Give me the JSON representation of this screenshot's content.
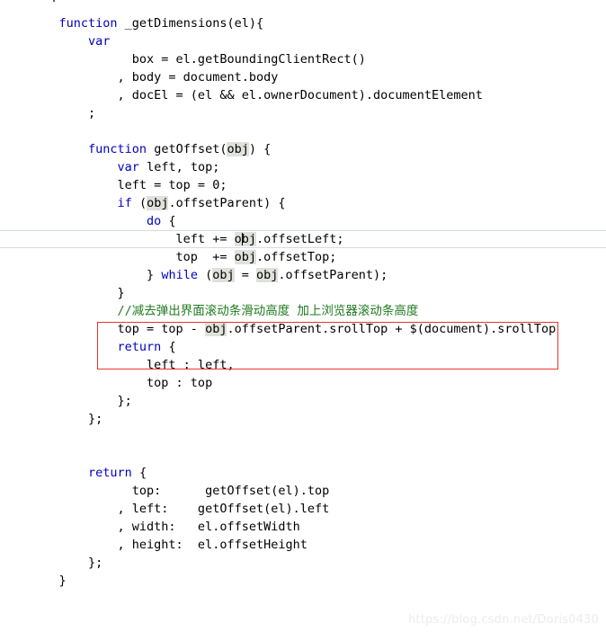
{
  "editor": {
    "language": "JavaScript",
    "background_color": "#ffffff",
    "keyword_color": "#0000c0",
    "comment_color": "#1f7a1f",
    "text_color": "#000000",
    "occurrence_highlight_color": "#dfe2da",
    "current_line_rule_color": "#d3dbe8",
    "top_clipped_glyph": "}",
    "lines": [
      {
        "id": 1,
        "indent": 3,
        "text": ""
      },
      {
        "id": 2,
        "indent": 3,
        "text": "function _getDimensions(el){"
      },
      {
        "id": 3,
        "indent": 7,
        "text": "var"
      },
      {
        "id": 4,
        "indent": 13,
        "text": "box = el.getBoundingClientRect()"
      },
      {
        "id": 5,
        "indent": 11,
        "text": ", body = document.body"
      },
      {
        "id": 6,
        "indent": 11,
        "text": ", docEl = (el && el.ownerDocument).documentElement"
      },
      {
        "id": 7,
        "indent": 7,
        "text": ";"
      },
      {
        "id": 8,
        "indent": 0,
        "text": ""
      },
      {
        "id": 9,
        "indent": 7,
        "text": "function getOffset(obj) {"
      },
      {
        "id": 10,
        "indent": 11,
        "text": "var left, top;"
      },
      {
        "id": 11,
        "indent": 11,
        "text": "left = top = 0;"
      },
      {
        "id": 12,
        "indent": 11,
        "text": "if (obj.offsetParent) {"
      },
      {
        "id": 13,
        "indent": 15,
        "text": "do {"
      },
      {
        "id": 14,
        "indent": 19,
        "text": "left += obj.offsetLeft;"
      },
      {
        "id": 15,
        "indent": 19,
        "text": "top  += obj.offsetTop;"
      },
      {
        "id": 16,
        "indent": 15,
        "text": "} while (obj = obj.offsetParent);"
      },
      {
        "id": 17,
        "indent": 11,
        "text": "}"
      },
      {
        "id": 18,
        "indent": 11,
        "text": "//减去弹出界面滚动条滑动高度 加上浏览器滚动条高度"
      },
      {
        "id": 19,
        "indent": 11,
        "text": "top = top - obj.offsetParent.srollTop + $(document).srollTop"
      },
      {
        "id": 20,
        "indent": 11,
        "text": "return {"
      },
      {
        "id": 21,
        "indent": 15,
        "text": "left : left,"
      },
      {
        "id": 22,
        "indent": 15,
        "text": "top : top"
      },
      {
        "id": 23,
        "indent": 11,
        "text": "};"
      },
      {
        "id": 24,
        "indent": 7,
        "text": "};"
      },
      {
        "id": 25,
        "indent": 0,
        "text": ""
      },
      {
        "id": 26,
        "indent": 0,
        "text": ""
      },
      {
        "id": 27,
        "indent": 7,
        "text": "return {"
      },
      {
        "id": 28,
        "indent": 13,
        "text": "top:      getOffset(el).top"
      },
      {
        "id": 29,
        "indent": 11,
        "text": ", left:    getOffset(el).left"
      },
      {
        "id": 30,
        "indent": 11,
        "text": ", width:   el.offsetWidth"
      },
      {
        "id": 31,
        "indent": 11,
        "text": ", height:  el.offsetHeight"
      },
      {
        "id": 32,
        "indent": 7,
        "text": "};"
      },
      {
        "id": 33,
        "indent": 3,
        "text": "}"
      }
    ]
  },
  "annotation": {
    "shape": "rectangle",
    "color": "#e8352b",
    "comment_text": "//减去弹出界面滚动条滑动高度 加上浏览器滚动条高度",
    "code_text": "top = top - obj.offsetParent.srollTop + $(document).srollTop"
  },
  "caret": {
    "line_id": 14,
    "inside_token": "obj"
  },
  "watermark": {
    "text": "https://blog.csdn.net/Doris0430",
    "color": "#ececec"
  }
}
